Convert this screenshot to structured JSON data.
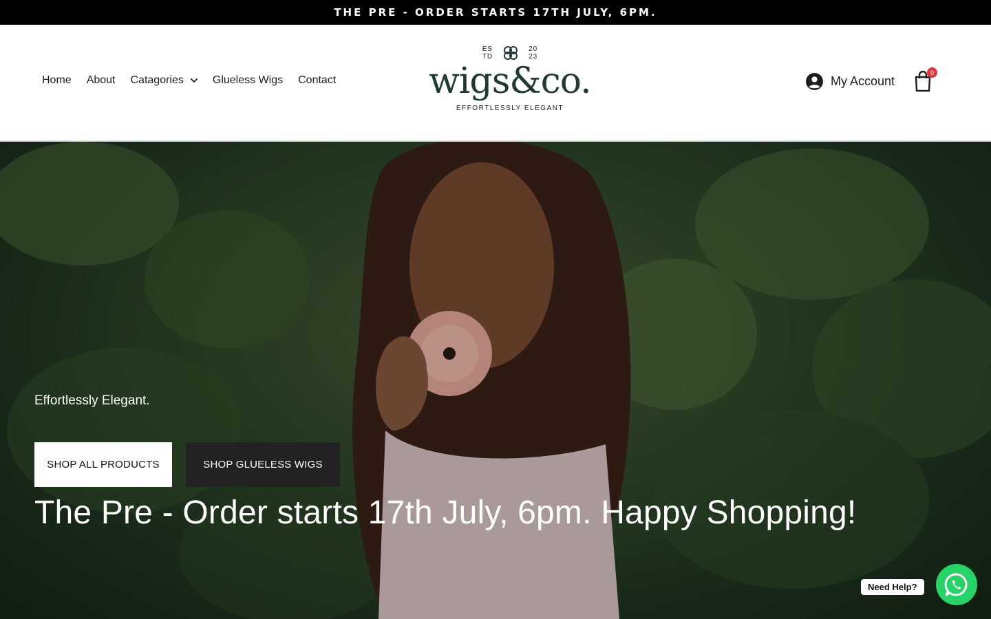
{
  "announcement": {
    "text": "THE PRE - ORDER STARTS 17TH JULY, 6PM."
  },
  "nav": {
    "items": [
      {
        "label": "Home"
      },
      {
        "label": "About"
      },
      {
        "label": "Catagories"
      },
      {
        "label": "Glueless Wigs"
      },
      {
        "label": "Contact"
      }
    ]
  },
  "logo": {
    "est_left_top": "ES",
    "est_left_bottom": "TD",
    "est_right_top": "20",
    "est_right_bottom": "23",
    "wordmark": "wigs&co.",
    "tagline": "EFFORTLESSLY ELEGANT"
  },
  "header": {
    "account_label": "My Account",
    "cart_count": "0"
  },
  "hero": {
    "subtitle": "Effortlessly Elegant.",
    "btn_all": "SHOP ALL PRODUCTS",
    "btn_glueless": "SHOP GLUELESS WIGS",
    "title": "The Pre - Order starts 17th July, 6pm. Happy Shopping!"
  },
  "chat": {
    "label": "Need Help?"
  },
  "colors": {
    "brand_green": "#1f3a35",
    "whatsapp": "#25d366",
    "badge": "#e0363a"
  },
  "icons": [
    "chevron-down-icon",
    "user-circle-icon",
    "shopping-bag-icon",
    "clover-icon",
    "whatsapp-icon"
  ]
}
